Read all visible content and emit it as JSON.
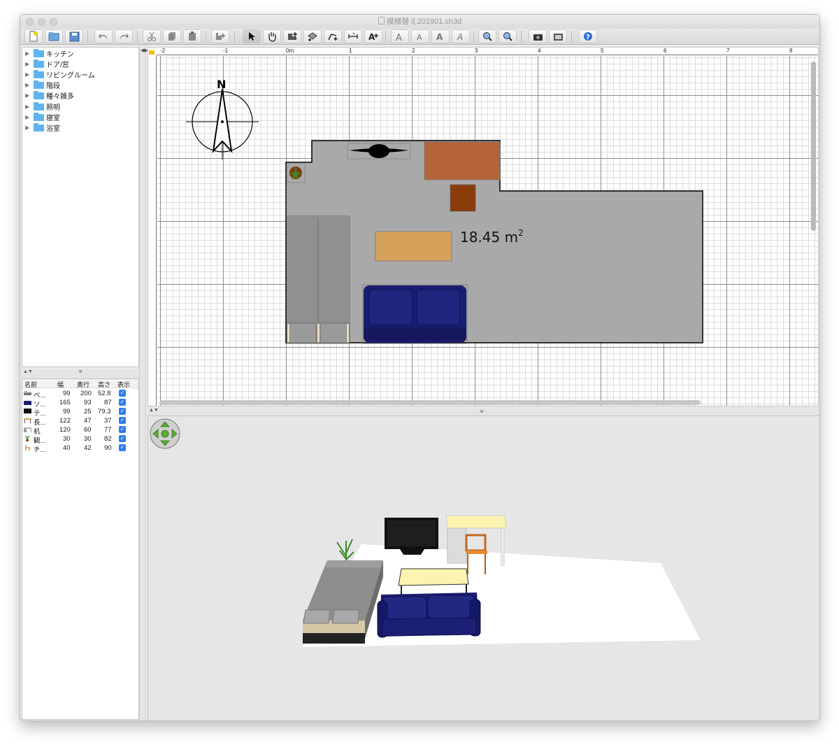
{
  "window": {
    "title": "模様替え201901.sh3d"
  },
  "toolbar": {
    "buttons": [
      {
        "name": "new-home",
        "icon": "new-document-icon"
      },
      {
        "name": "open",
        "icon": "folder-open-icon"
      },
      {
        "name": "save",
        "icon": "save-icon"
      },
      {
        "name": "undo",
        "icon": "undo-icon"
      },
      {
        "name": "redo",
        "icon": "redo-icon"
      },
      {
        "name": "cut",
        "icon": "cut-icon"
      },
      {
        "name": "copy",
        "icon": "copy-icon"
      },
      {
        "name": "paste",
        "icon": "paste-icon"
      },
      {
        "name": "add-furniture",
        "icon": "add-furniture-icon"
      },
      {
        "name": "select-mode",
        "icon": "arrow-cursor-icon"
      },
      {
        "name": "pan-mode",
        "icon": "hand-icon"
      },
      {
        "name": "create-walls",
        "icon": "create-walls-icon"
      },
      {
        "name": "create-rooms",
        "icon": "create-rooms-icon"
      },
      {
        "name": "create-polylines",
        "icon": "create-polylines-icon"
      },
      {
        "name": "create-dimensions",
        "icon": "create-dimensions-icon"
      },
      {
        "name": "create-labels",
        "icon": "add-text-icon"
      },
      {
        "name": "increase-text",
        "icon": "increase-text-size-icon"
      },
      {
        "name": "decrease-text",
        "icon": "decrease-text-size-icon"
      },
      {
        "name": "bold-text",
        "icon": "bold-text-icon"
      },
      {
        "name": "italic-text",
        "icon": "italic-text-icon"
      },
      {
        "name": "zoom-in",
        "icon": "zoom-in-icon"
      },
      {
        "name": "zoom-out",
        "icon": "zoom-out-icon"
      },
      {
        "name": "create-photo",
        "icon": "camera-icon"
      },
      {
        "name": "create-video",
        "icon": "video-icon"
      },
      {
        "name": "help",
        "icon": "help-icon"
      }
    ]
  },
  "catalog": {
    "categories": [
      {
        "label": "キッチン"
      },
      {
        "label": "ドア/窓"
      },
      {
        "label": "リビングルーム"
      },
      {
        "label": "階段"
      },
      {
        "label": "種々雑多"
      },
      {
        "label": "照明"
      },
      {
        "label": "寝室"
      },
      {
        "label": "浴室"
      }
    ]
  },
  "furniture_table": {
    "headers": {
      "name": "名前",
      "width": "幅",
      "depth": "奥行",
      "height": "高さ",
      "visible": "表示"
    },
    "rows": [
      {
        "name": "ベ...",
        "width": "99",
        "depth": "200",
        "height": "52.8",
        "visible": "✓",
        "icon": "bed-icon"
      },
      {
        "name": "ソ...",
        "width": "165",
        "depth": "93",
        "height": "87",
        "visible": "✓",
        "icon": "sofa-icon"
      },
      {
        "name": "テ...",
        "width": "99",
        "depth": "25",
        "height": "79.3",
        "visible": "✓",
        "icon": "tv-icon"
      },
      {
        "name": "長...",
        "width": "122",
        "depth": "47",
        "height": "37",
        "visible": "✓",
        "icon": "table-icon"
      },
      {
        "name": "机",
        "width": "120",
        "depth": "60",
        "height": "77",
        "visible": "✓",
        "icon": "desk-icon"
      },
      {
        "name": "観...",
        "width": "30",
        "depth": "30",
        "height": "82",
        "visible": "✓",
        "icon": "plant-icon"
      },
      {
        "name": "チ...",
        "width": "40",
        "depth": "42",
        "height": "90",
        "visible": "✓",
        "icon": "chair-icon"
      }
    ]
  },
  "plan": {
    "ruler_x": [
      "-2",
      "-1",
      "0m",
      "1",
      "2",
      "3",
      "4",
      "5",
      "6",
      "7",
      "8"
    ],
    "ruler_y": [
      "0m",
      "1",
      "2",
      "3",
      "4"
    ],
    "compass_letter": "N",
    "room_area": "18.45 m",
    "room_area_sup": "2"
  },
  "colors": {
    "accent": "#2f7ef2",
    "room_floor": "#a9a9a9",
    "desk_plan": "#b5643a",
    "table_plan": "#d5a05a",
    "sofa": "#1a1d70",
    "bed": "#8a8a8a"
  }
}
